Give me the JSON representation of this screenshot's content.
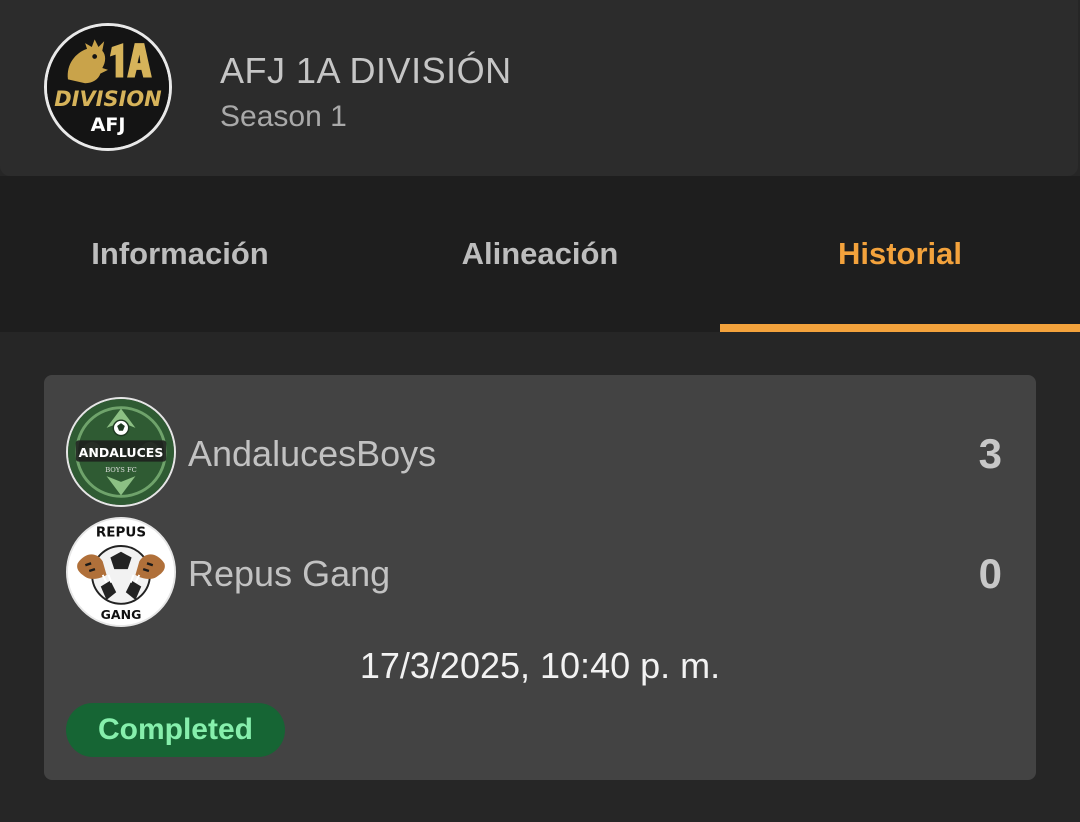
{
  "league": {
    "logo_icon": "division-1a-afj-logo",
    "logo_text": "1A DIVISION AFJ",
    "title": "AFJ 1A DIVISIÓN",
    "season": "Season 1"
  },
  "tabs": [
    {
      "label": "Información",
      "active": false
    },
    {
      "label": "Alineación",
      "active": false
    },
    {
      "label": "Historial",
      "active": true
    }
  ],
  "colors": {
    "accent": "#f3a23c",
    "status_bg": "#166534",
    "status_text": "#86efac"
  },
  "match": {
    "home": {
      "name": "AndalucesBoys",
      "score": "3",
      "logo_icon": "andaluces-boys-fc-crest",
      "logo_text": "ANDALUCES BOYS FC"
    },
    "away": {
      "name": "Repus Gang",
      "score": "0",
      "logo_icon": "repus-gang-crest",
      "logo_text": "REPUS GANG"
    },
    "datetime": "17/3/2025, 10:40 p. m.",
    "status": "Completed"
  }
}
